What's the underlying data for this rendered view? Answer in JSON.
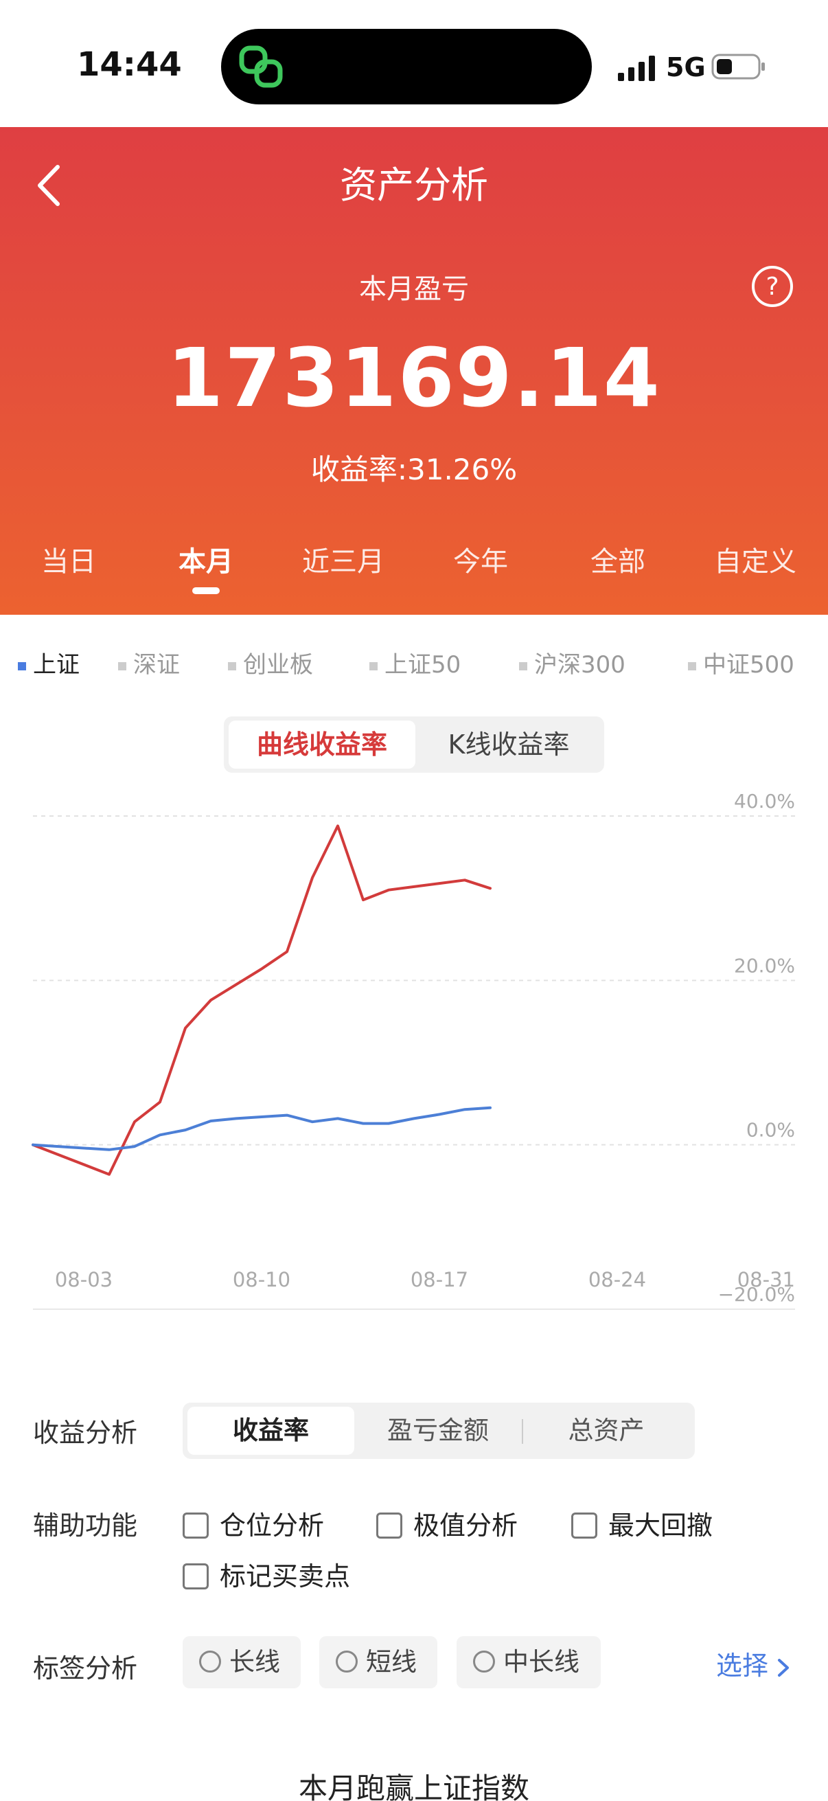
{
  "status_bar": {
    "time": "14:44",
    "network": "5G"
  },
  "header": {
    "title": "资产分析",
    "subtitle": "本月盈亏",
    "amount": "173169.14",
    "rate": "收益率:31.26%"
  },
  "period_tabs": [
    "当日",
    "本月",
    "近三月",
    "今年",
    "全部",
    "自定义"
  ],
  "active_tab": "本月",
  "indices": [
    "上证",
    "深证",
    "创业板",
    "上证50",
    "沪深300",
    "中证500"
  ],
  "active_index": "上证",
  "chart_toggle": {
    "curve": "曲线收益率",
    "kline": "K线收益率"
  },
  "chart_data": {
    "type": "line",
    "y_ticks": [
      "40.0%",
      "20.0%",
      "0.0%",
      "−20.0%"
    ],
    "x_ticks": [
      "08-03",
      "08-10",
      "08-17",
      "08-24",
      "08-31"
    ],
    "ylim": [
      -20,
      40
    ],
    "grid": true,
    "series": [
      {
        "color": "#d23b3b",
        "points": [
          [
            0,
            0
          ],
          [
            3,
            -3.6
          ],
          [
            4,
            2.8
          ],
          [
            5,
            5.2
          ],
          [
            6,
            14.2
          ],
          [
            7,
            17.6
          ],
          [
            8,
            19.5
          ],
          [
            9,
            21.4
          ],
          [
            10,
            23.5
          ],
          [
            11,
            32.5
          ],
          [
            12,
            38.8
          ],
          [
            13,
            29.8
          ],
          [
            14,
            31
          ],
          [
            15,
            31.4
          ],
          [
            16,
            31.8
          ],
          [
            17,
            32.2
          ],
          [
            18,
            31.2
          ]
        ]
      },
      {
        "color": "#4c7fd6",
        "points": [
          [
            0,
            0
          ],
          [
            3,
            -0.6
          ],
          [
            4,
            -0.2
          ],
          [
            5,
            1.2
          ],
          [
            6,
            1.8
          ],
          [
            7,
            2.9
          ],
          [
            8,
            3.2
          ],
          [
            9,
            3.4
          ],
          [
            10,
            3.6
          ],
          [
            11,
            2.8
          ],
          [
            12,
            3.2
          ],
          [
            13,
            2.6
          ],
          [
            14,
            2.6
          ],
          [
            15,
            3.2
          ],
          [
            16,
            3.7
          ],
          [
            17,
            4.3
          ],
          [
            18,
            4.5
          ]
        ]
      }
    ]
  },
  "analysis": {
    "profit_label": "收益分析",
    "profit_options": [
      "收益率",
      "盈亏金额",
      "总资产"
    ],
    "aux_label": "辅助功能",
    "aux_options": [
      "仓位分析",
      "极值分析",
      "最大回撤",
      "标记买卖点"
    ],
    "tag_label": "标签分析",
    "tag_options": [
      "长线",
      "短线",
      "中长线"
    ],
    "select": "选择"
  },
  "footer_title": "本月跑赢上证指数",
  "colors": {
    "accent_red": "#df3f42",
    "accent_orange": "#ec6230",
    "index_blue": "#4a7ce0"
  }
}
